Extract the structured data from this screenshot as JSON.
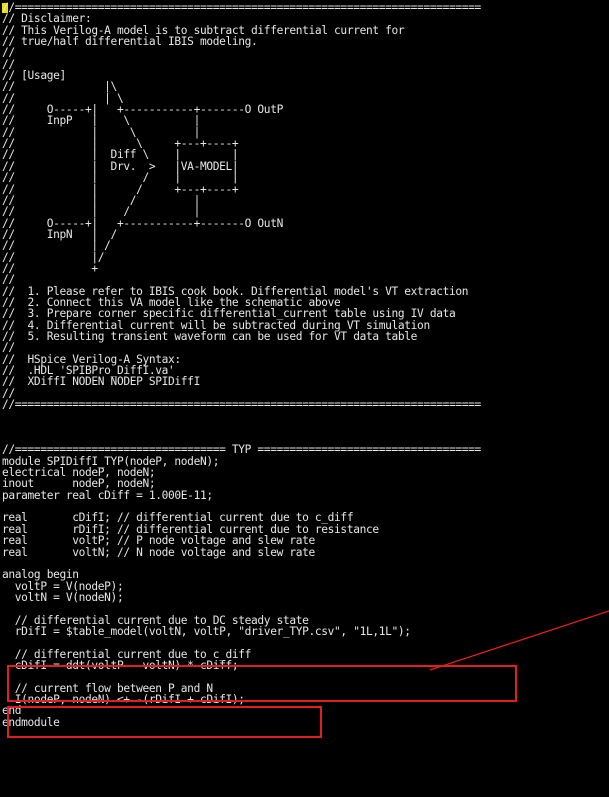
{
  "editor": {
    "lines": [
      "//=========================================================================",
      "// Disclaimer:",
      "// This Verilog-A model is to subtract differential current for",
      "// true/half differential IBIS modeling.",
      "//",
      "//",
      "// [Usage]",
      "//              |\\",
      "//              | \\",
      "//     O-----+|   +-----------+-------O OutP",
      "//     InpP   |    \\          |",
      "//            |     \\         |",
      "//            |      \\     +---+----+",
      "//            |  Diff \\    |        |",
      "//            |  Drv.  >   |VA-MODEL|",
      "//            |       /    |        |",
      "//            |      /     +---+----+",
      "//            |     /         |",
      "//            |    /          |",
      "//     O-----+|   +-----------+-------O OutN",
      "//     InpN   |  /",
      "//            | /",
      "//            |/",
      "//            +",
      "//",
      "//  1. Please refer to IBIS cook book. Differential model's VT extraction",
      "//  2. Connect this VA model like the schematic above",
      "//  3. Prepare corner specific differential_current table using IV data",
      "//  4. Differential current will be subtracted during VT simulation",
      "//  5. Resulting transient waveform can be used for VT data table",
      "//",
      "//  HSpice Verilog-A Syntax:",
      "//  .HDL 'SPIBPro_DiffI.va'",
      "//  XDiffI NODEN NODEP SPIDiffI",
      "//",
      "//=========================================================================",
      "",
      "",
      "",
      "//================================= TYP ===================================",
      "module SPIDiffI_TYP(nodeP, nodeN);",
      "electrical nodeP, nodeN;",
      "inout      nodeP, nodeN;",
      "parameter real cDiff = 1.000E-11;",
      "",
      "real       cDifI; // differential current due to c_diff",
      "real       rDifI; // differential current due to resistance",
      "real       voltP; // P node voltage and slew rate",
      "real       voltN; // N node voltage and slew rate",
      "",
      "analog begin",
      "  voltP = V(nodeP);",
      "  voltN = V(nodeN);",
      "",
      "  // differential current due to DC steady state",
      "  rDifI = $table_model(voltN, voltP, \"driver_TYP.csv\", \"1L,1L\");",
      "",
      "  // differential current due to c_diff",
      "  cDifI = ddt(voltP - voltN) * cDiff;",
      "",
      "  // current flow between P and N",
      "  I(nodeP, nodeN) <+ -(rDifI + cDifI);",
      "end",
      "endmodule"
    ]
  },
  "colors": {
    "background": "#000000",
    "text": "#e6e6e6",
    "highlight": "#e02020",
    "cursor": "#e8e000"
  }
}
